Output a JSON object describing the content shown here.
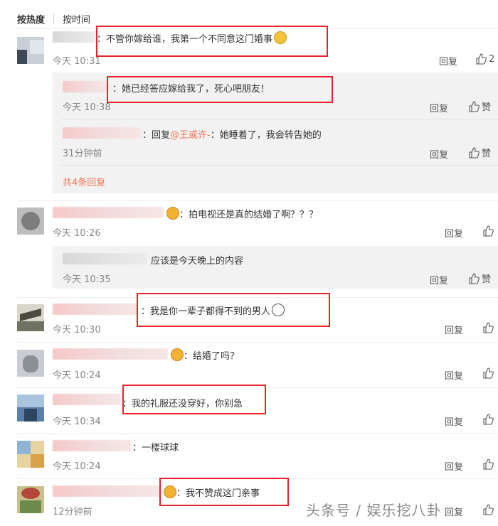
{
  "tabs": {
    "hot": "按热度",
    "time": "按时间"
  },
  "labels": {
    "reply": "回复",
    "like": "赞"
  },
  "colors": {
    "accent": "#eb7350",
    "highlight_box": "#e8232b"
  },
  "comments": [
    {
      "text": "：不管你嫁给谁，我第一个不同意这门婚事",
      "time": "今天 10:31",
      "like_count": "2"
    },
    {
      "text": "：拍电视还是真的结婚了啊？？？",
      "time": "今天 10:26"
    },
    {
      "text": "：我是你一辈子都得不到的男人",
      "time": "今天 10:30"
    },
    {
      "text": "：结婚了吗？",
      "time": "今天 10:24"
    },
    {
      "text": "：我的礼服还没穿好，你别急",
      "time": "今天 10:34"
    },
    {
      "text": "：一楼球球",
      "time": "今天 10:24"
    },
    {
      "text": "：我不赞成这门亲事",
      "time": "12分钟前"
    }
  ],
  "replies": [
    {
      "text": "：她已经答应嫁给我了，死心吧朋友！",
      "time": "今天 10:38"
    },
    {
      "prefix": "：回复",
      "mention": "@王或许-",
      "text": "：她睡着了，我会转告她的",
      "time": "31分钟前"
    },
    {
      "text": "应该是今天晚上的内容",
      "time": "今天 10:35"
    }
  ],
  "more_replies": "共4条回复",
  "watermark": "头条号 / 娱乐挖八卦"
}
